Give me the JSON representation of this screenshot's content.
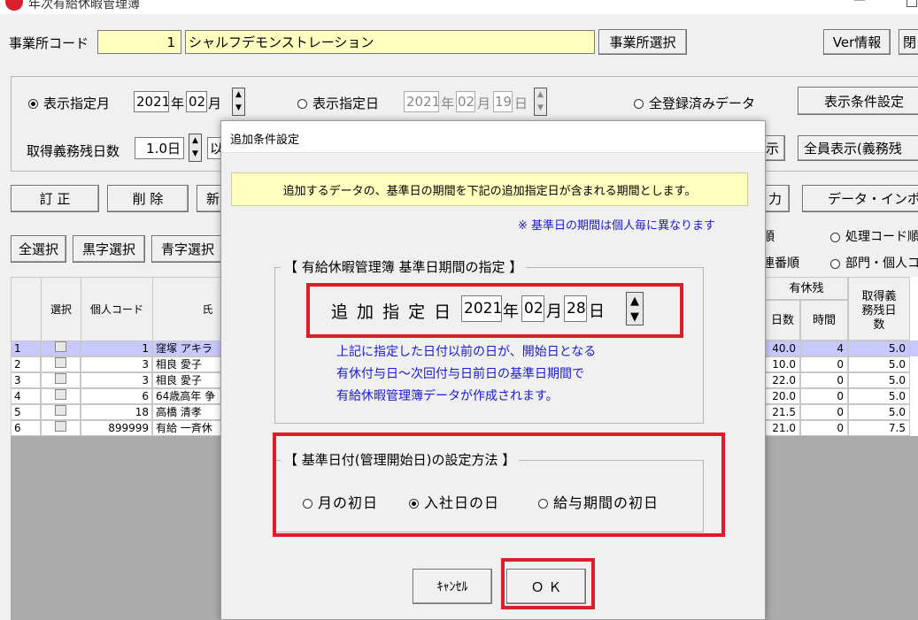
{
  "window": {
    "title": "年次有給休暇管理簿",
    "app_icon": "app-logo",
    "minimize_glyph": "—"
  },
  "office": {
    "code_label": "事業所コード",
    "code_value": "1",
    "name_value": "シャルフデモンストレーション",
    "select_button": "事業所選択",
    "ver_button": "Ver情報",
    "right_button": "閉"
  },
  "filter": {
    "month_radio": "表示指定月",
    "month_year": "2021",
    "year_unit": "年",
    "month_value": "02",
    "month_unit": "月",
    "day_radio": "表示指定日",
    "day_year": "2021",
    "day_month": "02",
    "day_day": "19",
    "day_unit": "日",
    "all_radio": "全登録済みデータ",
    "condition_button": "表示条件設定",
    "remain_label": "取得義務残日数",
    "remain_value": "1.0日",
    "remain_suffix": "以",
    "show_button_tail": "示",
    "all_show_button": "全員表示(義務残"
  },
  "actions": {
    "fix": "訂 正",
    "delete": "削 除",
    "new": "新",
    "output_tail": "力",
    "import": "データ・インポー"
  },
  "select_buttons": {
    "all": "全選択",
    "black": "黒字選択",
    "blue": "青字選択"
  },
  "sort": {
    "tail_top": "順",
    "code_radio": "処理コード順",
    "serial_tail": "連番順",
    "dept_radio": "部門・個人コ"
  },
  "table": {
    "headers": {
      "select": "選択",
      "code": "個人コード",
      "name": "氏",
      "remain_group": "有休残",
      "days": "日数",
      "hours": "時間",
      "obligation": "取得義務残日数"
    },
    "rows": [
      {
        "no": "1",
        "code": "1",
        "name": "窪塚 アキラ",
        "days": "40.0",
        "hours": "4",
        "obl": "5.0"
      },
      {
        "no": "2",
        "code": "3",
        "name": "相良 愛子",
        "days": "10.0",
        "hours": "0",
        "obl": "5.0"
      },
      {
        "no": "3",
        "code": "3",
        "name": "相良 愛子",
        "days": "22.0",
        "hours": "0",
        "obl": "5.0"
      },
      {
        "no": "4",
        "code": "6",
        "name": "64歳高年 争",
        "days": "20.0",
        "hours": "0",
        "obl": "5.0"
      },
      {
        "no": "5",
        "code": "18",
        "name": "高橋 清孝",
        "days": "21.5",
        "hours": "0",
        "obl": "5.0"
      },
      {
        "no": "6",
        "code": "899999",
        "name": "有給 一斉休",
        "days": "21.0",
        "hours": "0",
        "obl": "7.5"
      }
    ]
  },
  "dialog": {
    "title": "追加条件設定",
    "notice": "追加するデータの、基準日の期間を下記の追加指定日が含まれる期間とします。",
    "note": "※ 基準日の期間は個人毎に異なります",
    "group1_title": "【 有給休暇管理簿  基準日期間の指定 】",
    "date_label": "追 加 指 定 日",
    "year": "2021",
    "year_unit": "年",
    "month": "02",
    "month_unit": "月",
    "day": "28",
    "day_unit": "日",
    "info1": "上記に指定した日付以前の日が、開始日となる",
    "info2": "有休付与日～次回付与日前日の基準日期間で",
    "info3": "有給休暇管理簿データが作成されます。",
    "group2_title": "【 基準日付(管理開始日)の設定方法 】",
    "opt1": "月の初日",
    "opt2": "入社日の日",
    "opt3": "給与期間の初日",
    "cancel": "ｷｬﾝｾﾙ",
    "ok": "Ｏ Ｋ"
  },
  "colors": {
    "highlight": "#d9202a",
    "yellow_field": "#ffffc0",
    "selected_row": "#c8c8ff",
    "blue_text": "#1a1ad0"
  }
}
